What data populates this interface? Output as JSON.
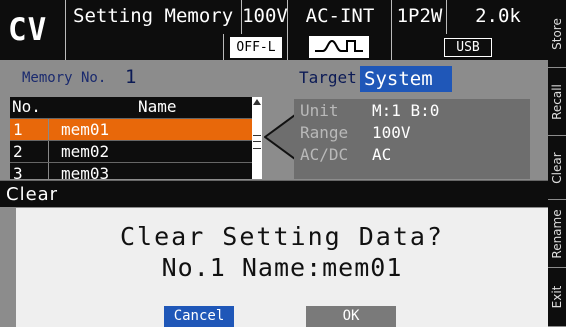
{
  "status_bar": {
    "mode": "CV",
    "screen_title": "Setting Memory",
    "voltage_range": "100V",
    "source": "AC-INT",
    "wiring": "1P2W",
    "frequency": "2.0k",
    "output_limit": "OFF-L",
    "waveform_icon": "sine-wave-icon",
    "interface": "USB"
  },
  "memory": {
    "label": "Memory No.",
    "number": "1",
    "target_label": "Target",
    "target_value": "System"
  },
  "list": {
    "header_no": "No.",
    "header_name": "Name",
    "rows": [
      {
        "no": "1",
        "name": "mem01",
        "selected": true
      },
      {
        "no": "2",
        "name": "mem02",
        "selected": false
      },
      {
        "no": "3",
        "name": "mem03",
        "selected": false
      }
    ]
  },
  "info": {
    "unit_label": "Unit",
    "unit_value": "M:1 B:0",
    "range_label": "Range",
    "range_value": "100V",
    "acdc_label": "AC/DC",
    "acdc_value": "AC"
  },
  "dialog": {
    "title": "Clear",
    "line1": "Clear Setting Data?",
    "line2": "No.1 Name:mem01",
    "cancel_label": "Cancel",
    "ok_label": "OK"
  },
  "softkeys": [
    "Store",
    "Recall",
    "Clear",
    "Rename",
    "Exit"
  ],
  "colors": {
    "selected_row": "#e8680a",
    "accent_blue": "#1f57b8",
    "panel_grey": "#8c8c8c",
    "bar_black": "#0d0d0d"
  }
}
